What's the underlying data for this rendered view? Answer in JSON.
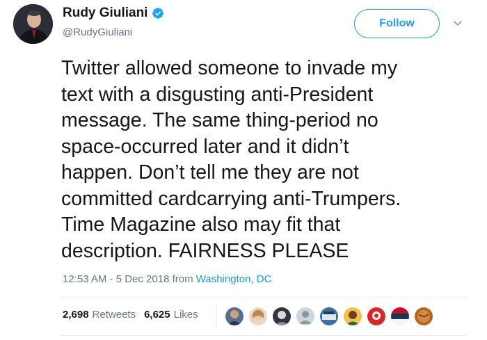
{
  "author": {
    "name": "Rudy Giuliani",
    "handle": "@RudyGiuliani",
    "verified": true
  },
  "actions": {
    "follow_label": "Follow"
  },
  "tweet": {
    "text": "Twitter allowed someone to invade my\ntext with a disgusting anti-President\nmessage. The same thing-period no\nspace-occurred later and it didn’t\nhappen. Don’t tell me they are not\ncommitted cardcarrying anti-Trumpers.\nTime Magazine also may fit that\ndescription. FAIRNESS PLEASE"
  },
  "meta": {
    "time_date": "12:53 AM - 5 Dec 2018 from ",
    "location": "Washington, DC"
  },
  "stats": {
    "retweets_count": "2,698",
    "retweets_label": "Retweets",
    "likes_count": "6,625",
    "likes_label": "Likes"
  },
  "colors": {
    "accent": "#1da1f2",
    "text": "#14171a",
    "muted": "#657786"
  }
}
